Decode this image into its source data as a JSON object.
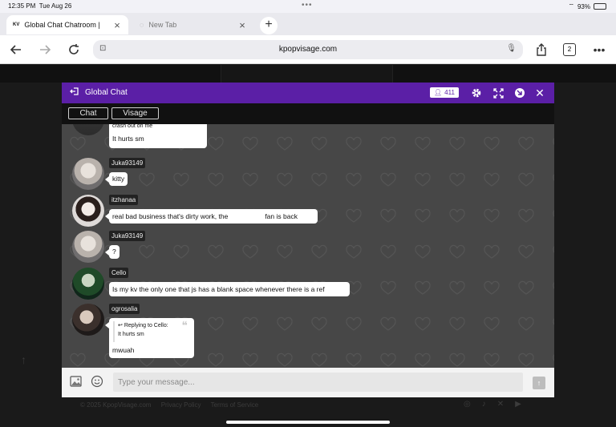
{
  "status_bar": {
    "time": "12:35 PM",
    "date": "Tue Aug 26",
    "battery": "93%",
    "battery_level": 0.93
  },
  "browser": {
    "tabs": [
      {
        "label": "Global Chat Chatroom |",
        "favicon": "KV",
        "active": true
      },
      {
        "label": "New Tab",
        "active": false
      }
    ],
    "url": "kpopvisage.com",
    "tab_count": "2"
  },
  "chat": {
    "title": "Global Chat",
    "online_count": "411",
    "tabs": [
      "Chat",
      "Visage"
    ],
    "messages": [
      {
        "user": "",
        "lines": [
          "crash out on me",
          "It hurts sm"
        ],
        "partial": true
      },
      {
        "user": "Juka93149",
        "text": "kitty"
      },
      {
        "user": "itzhanaa",
        "text_before": "real bad business that's dirty work, the",
        "text_after": "fan is back"
      },
      {
        "user": "Juka93149",
        "text": "?"
      },
      {
        "user": "Cello",
        "text": "Is my kv the only one that js has a blank space whenever there is a ref"
      },
      {
        "user": "ogrosalia",
        "reply_label": "Replying to Cello:",
        "reply_text": "It hurts sm",
        "text": "mwuah"
      }
    ],
    "composer_placeholder": "Type your message..."
  },
  "page": {
    "footer": {
      "copyright": "© 2025 KpopVisage.com",
      "privacy": "Privacy Policy",
      "terms": "Terms of Service"
    }
  },
  "colors": {
    "header": "#5b1fa6",
    "chat_bg": "#474747",
    "tabs_bg": "#111111"
  }
}
